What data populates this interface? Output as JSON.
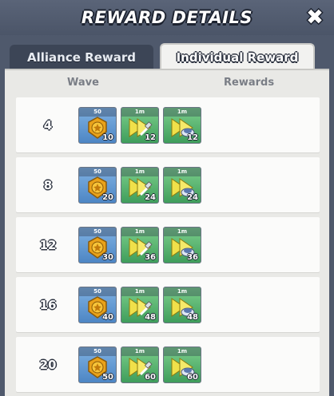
{
  "title": "REWARD DETAILS",
  "tabs": {
    "alliance": "Alliance Reward",
    "individual": "Individual Reward"
  },
  "columns": {
    "wave": "Wave",
    "rewards": "Rewards"
  },
  "rows": [
    {
      "wave": "4",
      "items": [
        {
          "label": "50",
          "count": "10",
          "icon": "gold-medal-icon"
        },
        {
          "label": "1m",
          "count": "12",
          "icon": "speedup-build-icon"
        },
        {
          "label": "1m",
          "count": "12",
          "icon": "speedup-research-icon"
        }
      ]
    },
    {
      "wave": "8",
      "items": [
        {
          "label": "50",
          "count": "20",
          "icon": "gold-medal-icon"
        },
        {
          "label": "1m",
          "count": "24",
          "icon": "speedup-build-icon"
        },
        {
          "label": "1m",
          "count": "24",
          "icon": "speedup-research-icon"
        }
      ]
    },
    {
      "wave": "12",
      "items": [
        {
          "label": "50",
          "count": "30",
          "icon": "gold-medal-icon"
        },
        {
          "label": "1m",
          "count": "36",
          "icon": "speedup-build-icon"
        },
        {
          "label": "1m",
          "count": "36",
          "icon": "speedup-research-icon"
        }
      ]
    },
    {
      "wave": "16",
      "items": [
        {
          "label": "50",
          "count": "40",
          "icon": "gold-medal-icon"
        },
        {
          "label": "1m",
          "count": "48",
          "icon": "speedup-build-icon"
        },
        {
          "label": "1m",
          "count": "48",
          "icon": "speedup-research-icon"
        }
      ]
    },
    {
      "wave": "20",
      "items": [
        {
          "label": "50",
          "count": "50",
          "icon": "gold-medal-icon"
        },
        {
          "label": "1m",
          "count": "60",
          "icon": "speedup-build-icon"
        },
        {
          "label": "1m",
          "count": "60",
          "icon": "speedup-research-icon"
        }
      ]
    }
  ],
  "colors": {
    "header_bg": "#4f596c",
    "panel_bg": "#e9e9e6",
    "tile_blue": "#5b93cf",
    "tile_green": "#4fae6a"
  }
}
